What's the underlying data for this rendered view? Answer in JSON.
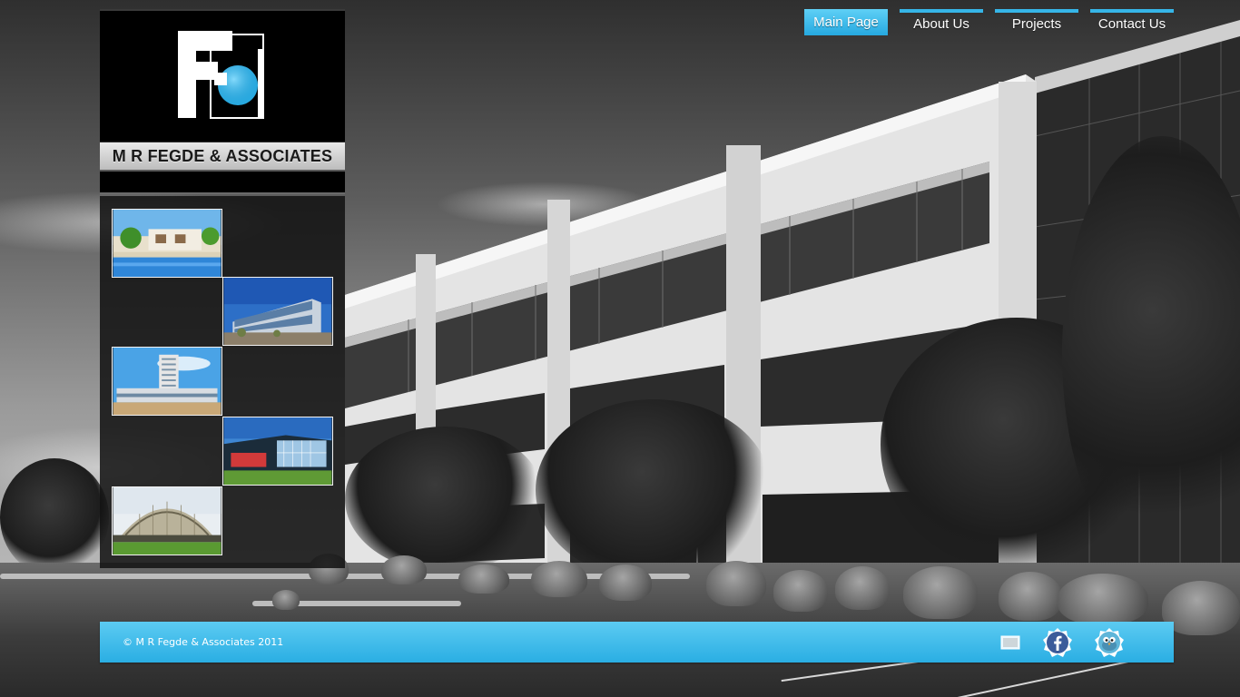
{
  "brand": {
    "name": "M R FEGDE & ASSOCIATES",
    "logo_letters": "Fa"
  },
  "nav": {
    "items": [
      {
        "label": "Main Page",
        "active": true
      },
      {
        "label": "About Us",
        "active": false
      },
      {
        "label": "Projects",
        "active": false
      },
      {
        "label": "Contact Us",
        "active": false
      }
    ]
  },
  "gallery": {
    "thumbnails": [
      {
        "icon": "resort-pool-photo"
      },
      {
        "icon": "office-building-photo"
      },
      {
        "icon": "hotel-tower-photo"
      },
      {
        "icon": "glass-building-photo"
      },
      {
        "icon": "dome-structure-photo"
      }
    ]
  },
  "footer": {
    "copyright": "© M R Fegde & Associates 2011",
    "icons": [
      "screen-icon",
      "facebook-icon",
      "twitter-icon"
    ]
  },
  "colors": {
    "accent": "#2aaee3",
    "accent_light": "#5ccbf2",
    "sidebar": "#000000"
  }
}
